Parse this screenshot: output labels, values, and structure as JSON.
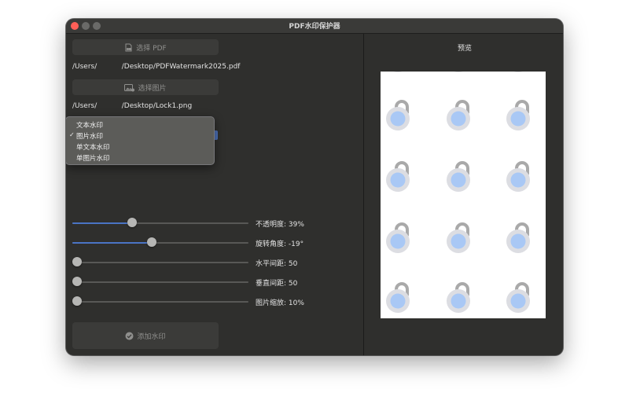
{
  "window": {
    "title": "PDF水印保护器"
  },
  "left": {
    "select_pdf_label": "选择 PDF",
    "pdf_path": "/Users/           /Desktop/PDFWatermark2025.pdf",
    "select_image_label": "选择图片",
    "image_path": "/Users/           /Desktop/Lock1.png",
    "mode_menu": {
      "options": [
        "文本水印",
        "图片水印",
        "单文本水印",
        "单图片水印"
      ],
      "selected": "图片水印"
    },
    "sliders": [
      {
        "id": "opacity",
        "label": "不透明度: 39%",
        "fraction": 0.33
      },
      {
        "id": "rotation",
        "label": "旋转角度: -19°",
        "fraction": 0.45
      },
      {
        "id": "h-spacing",
        "label": "水平间距: 50",
        "fraction": 0.0
      },
      {
        "id": "v-spacing",
        "label": "垂直间距: 50",
        "fraction": 0.0
      },
      {
        "id": "scale",
        "label": "图片缩放: 10%",
        "fraction": 0.0
      }
    ],
    "add_watermark_label": "添加水印"
  },
  "right": {
    "preview_label": "预览"
  },
  "colors": {
    "window_bg": "#2f2f2d",
    "accent": "#4a74c4",
    "lock_shackle": "#a9a9a9",
    "lock_body": "#dcdde2",
    "lock_center": "#a9c8f5"
  },
  "icons": [
    "traffic-light-close",
    "pdf-file-icon",
    "image-icon",
    "checkmark-circle-icon",
    "checkmark-icon",
    "lock-watermark-icon"
  ]
}
